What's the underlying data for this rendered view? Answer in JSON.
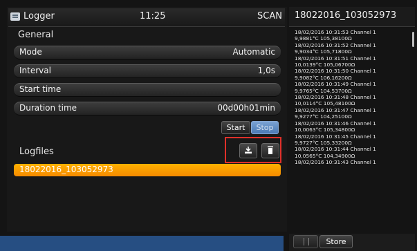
{
  "header": {
    "app_title": "Logger",
    "time": "11:25",
    "mode_status": "SCAN",
    "file_title": "18022016_103052973"
  },
  "general": {
    "section_label": "General",
    "fields": [
      {
        "label": "Mode",
        "value": "Automatic"
      },
      {
        "label": "Interval",
        "value": "1,0s"
      },
      {
        "label": "Start time",
        "value": ""
      },
      {
        "label": "Duration time",
        "value": "00d00h01min"
      }
    ]
  },
  "controls": {
    "start_label": "Start",
    "stop_label": "Stop"
  },
  "logfiles": {
    "section_label": "Logfiles",
    "items": [
      "18022016_103052973"
    ]
  },
  "log": {
    "lines": [
      "18/02/2016 10:31:53 Channel 1",
      "9,9881°C 105,38100Ω",
      "18/02/2016 10:31:52 Channel 1",
      "9,9034°C 105,71800Ω",
      "18/02/2016 10:31:51 Channel 1",
      "10,0139°C 105,06700Ω",
      "18/02/2016 10:31:50 Channel 1",
      "9,9082°C 106,16200Ω",
      "18/02/2016 10:31:49 Channel 1",
      "9,9765°C 104,53700Ω",
      "18/02/2016 10:31:48 Channel 1",
      "10,0114°C 105,48100Ω",
      "18/02/2016 10:31:47 Channel 1",
      "9,9277°C 104,25100Ω",
      "18/02/2016 10:31:46 Channel 1",
      "10,0063°C 105,34800Ω",
      "18/02/2016 10:31:45 Channel 1",
      "9,9727°C 105,33200Ω",
      "18/02/2016 10:31:44 Channel 1",
      "10,0565°C 104,34900Ω",
      "18/02/2016 10:31:43 Channel 1"
    ],
    "store_label": "Store"
  },
  "icons": {
    "app": "list-icon",
    "download": "download-icon",
    "delete": "trash-icon",
    "grip": "grip-icon"
  },
  "colors": {
    "selected_file": "#f59a00",
    "stop_button": "#5b86c0",
    "status_bar": "#264e82",
    "highlight": "#e0302a"
  }
}
